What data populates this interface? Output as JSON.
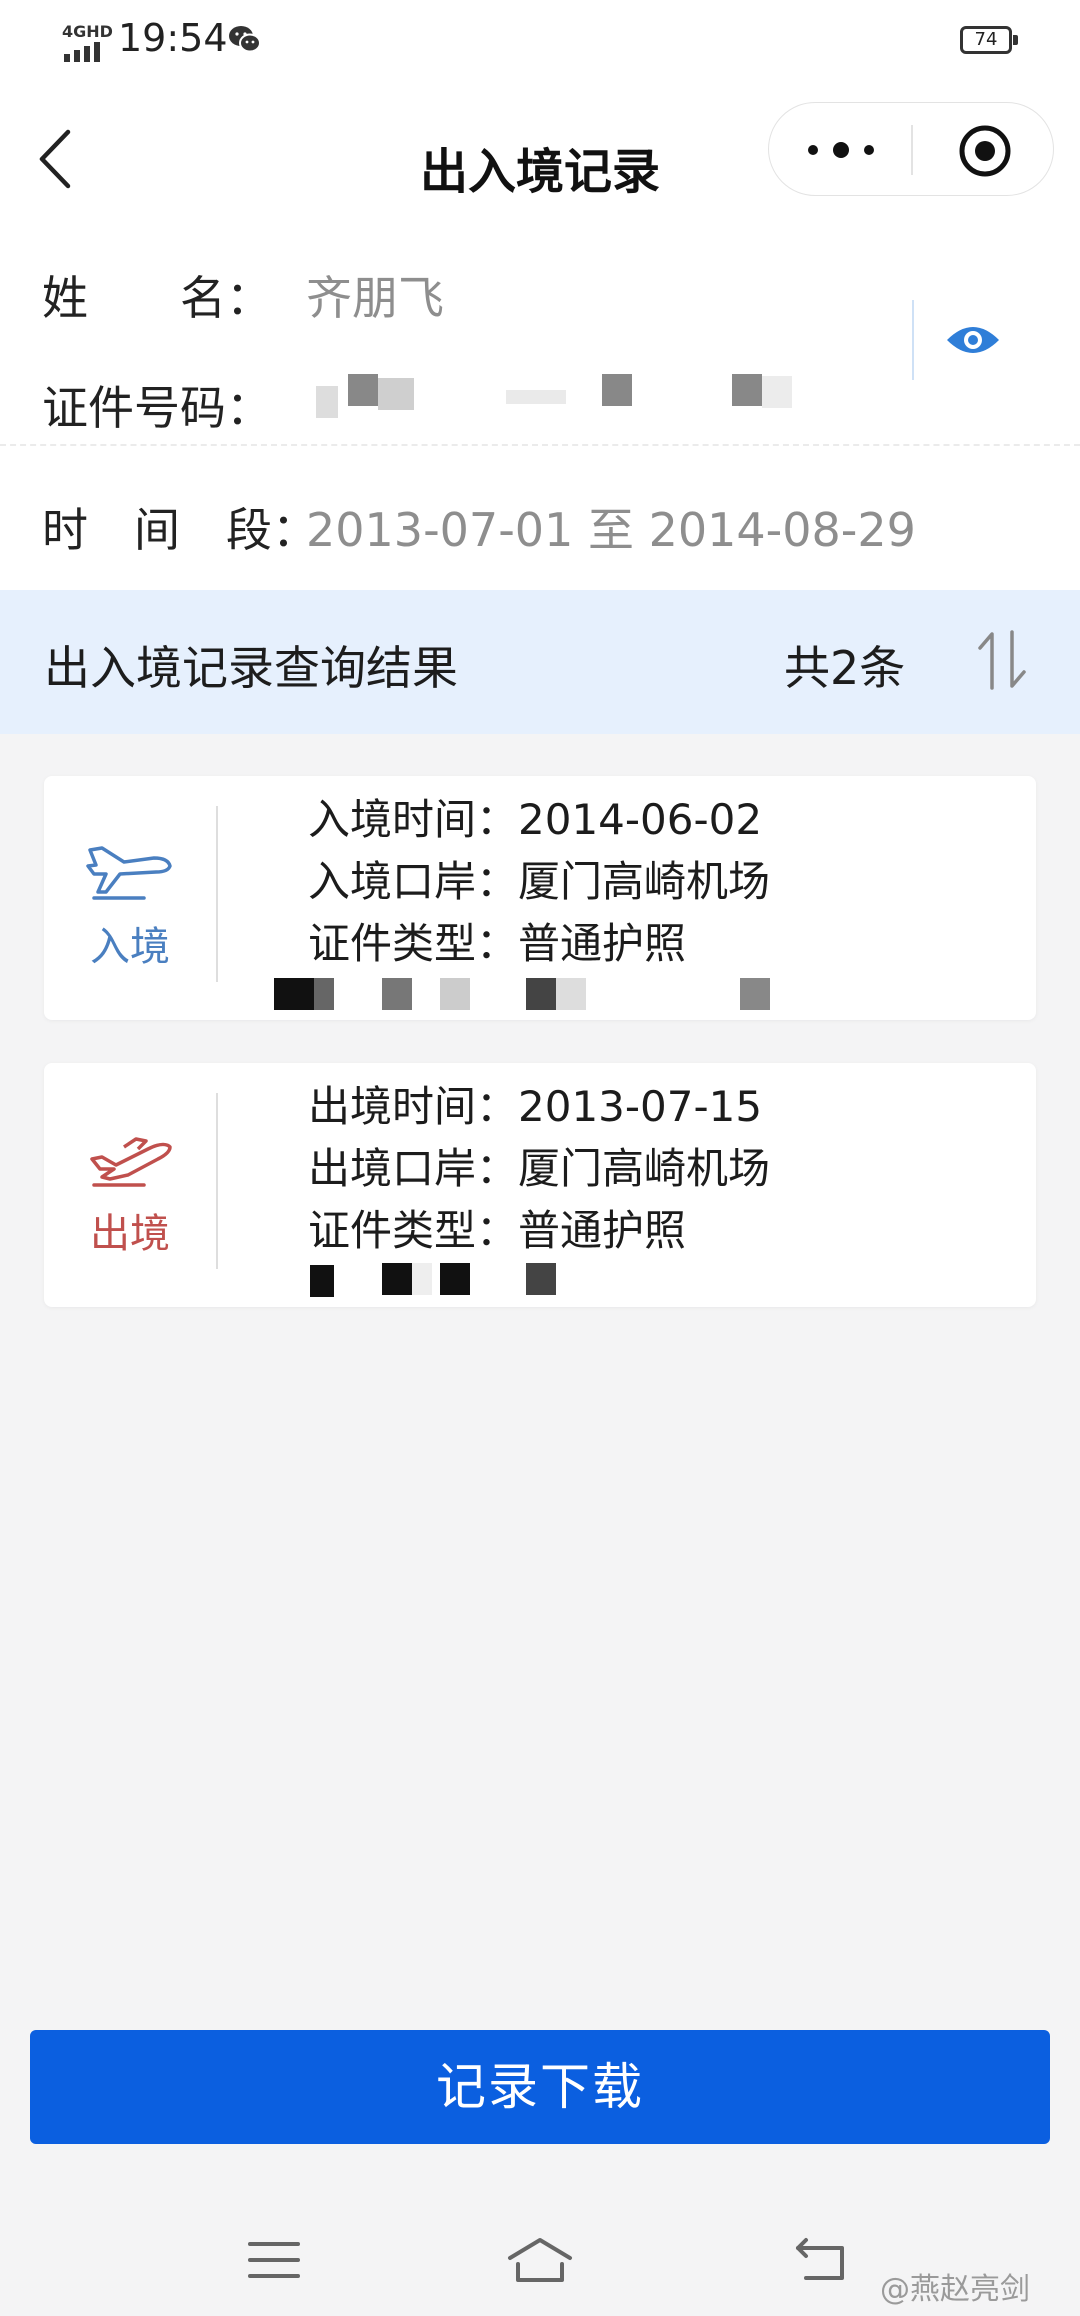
{
  "status_bar": {
    "network": "4GHD",
    "time": "19:54",
    "battery": "74"
  },
  "nav": {
    "title": "出入境记录"
  },
  "info": {
    "name_label": "姓　　名：",
    "name_value": "齐朋飞",
    "id_label": "证件号码：",
    "period_label": "时　间　段：",
    "period_value": "2013-07-01 至 2014-08-29"
  },
  "result": {
    "title": "出入境记录查询结果",
    "count": "共2条"
  },
  "records": [
    {
      "direction": "入境",
      "color": "#4a7fc0",
      "time_line": "入境时间：2014-06-02",
      "port_line": "入境口岸：厦门高崎机场",
      "doc_line": "证件类型：普通护照"
    },
    {
      "direction": "出境",
      "color": "#c0504d",
      "time_line": "出境时间：2013-07-15",
      "port_line": "出境口岸：厦门高崎机场",
      "doc_line": "证件类型：普通护照"
    }
  ],
  "download_label": "记录下载",
  "watermark": "@燕赵亮剑"
}
